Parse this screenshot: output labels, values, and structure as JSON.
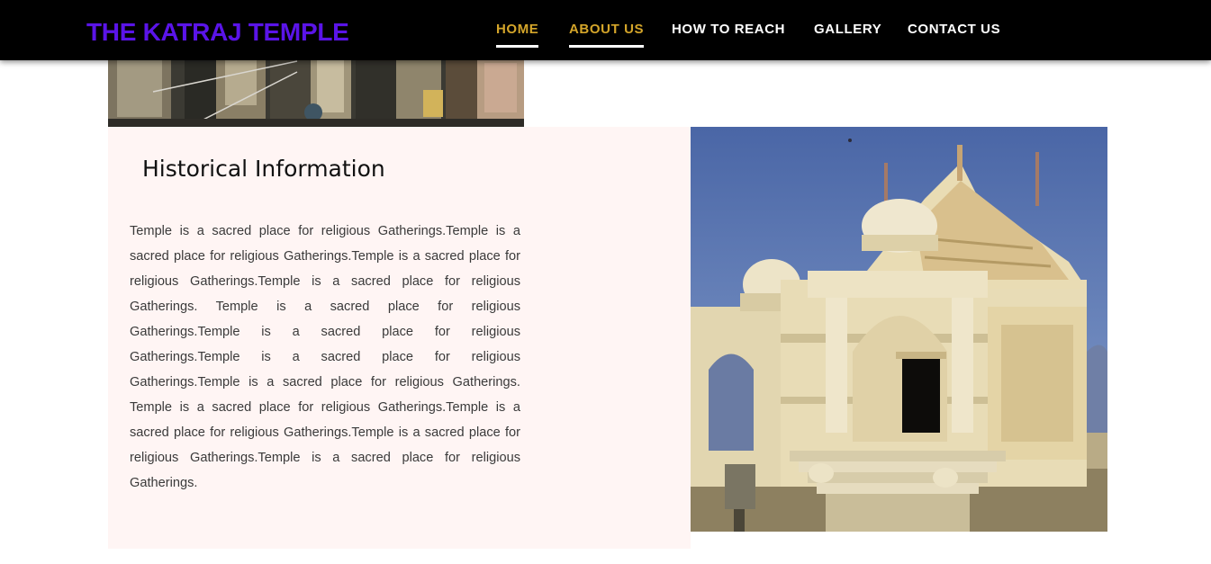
{
  "navbar": {
    "brand": "THE KATRAJ TEMPLE",
    "links": [
      {
        "label": "HOME",
        "active": true
      },
      {
        "label": "ABOUT US",
        "active": true
      },
      {
        "label": "HOW TO REACH",
        "active": false
      },
      {
        "label": "GALLERY",
        "active": false
      },
      {
        "label": "CONTACT US",
        "active": false
      }
    ]
  },
  "colors": {
    "navbar_bg": "#000000",
    "brand": "#5a14e8",
    "active_link": "#d4a52a",
    "link": "#ffffff",
    "panel_bg": "#fff5f4",
    "sky": "#4f6fae",
    "marble": "#e8dcb6"
  },
  "main": {
    "section_title": "Historical Information",
    "paragraph": "Temple is a sacred place for religious Gatherings.Temple is a sacred place for religious Gatherings.Temple is a sacred place for religious Gatherings.Temple is a sacred place for religious Gatherings. Temple is a sacred place for religious Gatherings.Temple is a sacred place for religious Gatherings.Temple is a sacred place for religious Gatherings.Temple is a sacred place for religious Gatherings. Temple is a sacred place for religious Gatherings.Temple is a sacred place for religious Gatherings.Temple is a sacred place for religious Gatherings.Temple is a sacred place for religious Gatherings."
  }
}
